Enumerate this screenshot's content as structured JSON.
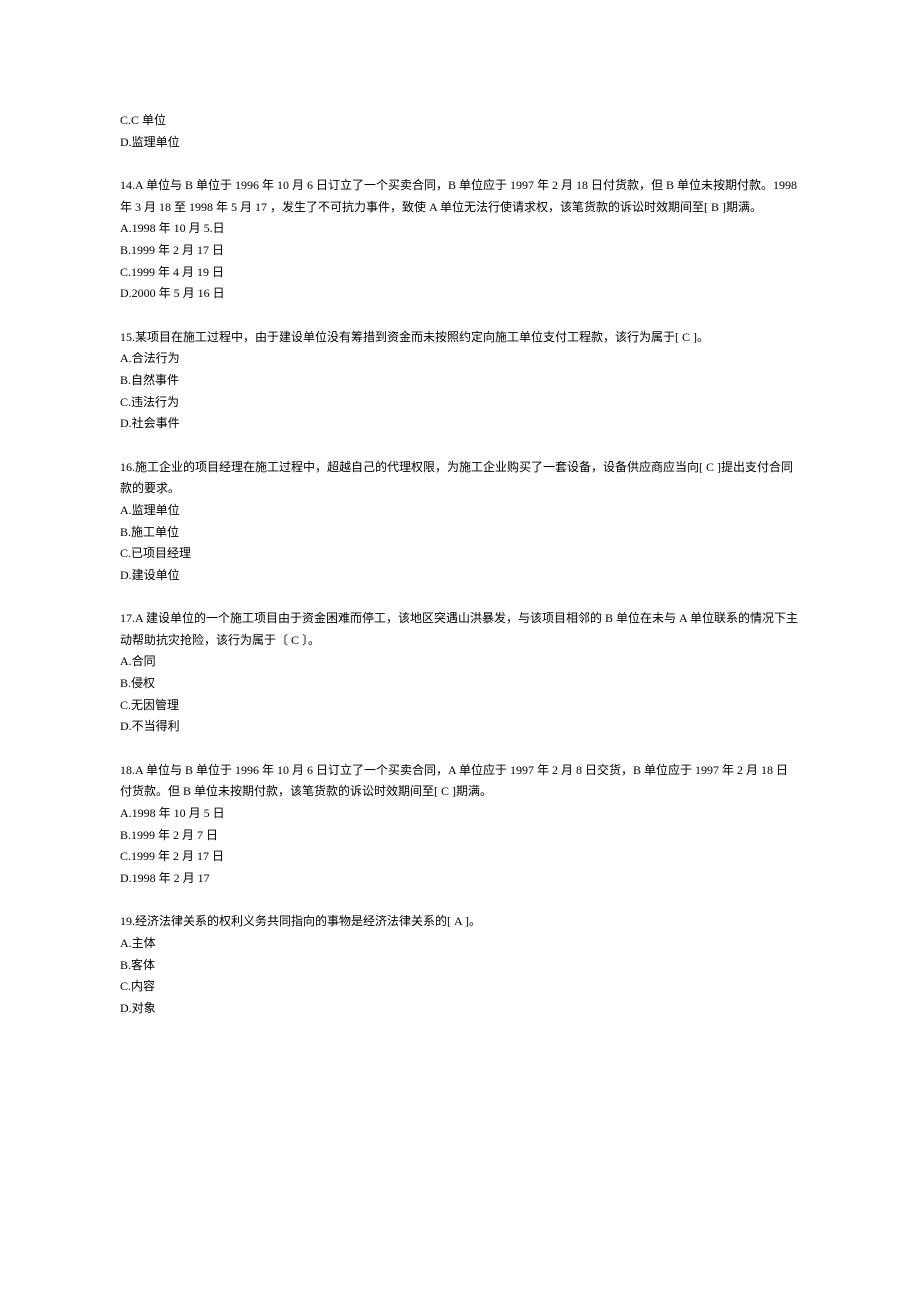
{
  "q13_tail": {
    "optC": "C.C 单位",
    "optD": "D.监理单位"
  },
  "q14": {
    "text": "14.A 单位与 B 单位于 1996 年 10 月 6 日订立了一个买卖合同，B 单位应于 1997 年 2 月 18 日付货款，但 B 单位未按期付款。1998 年 3 月 18 至 1998 年 5 月 17 ，发生了不可抗力事件，致使 A 单位无法行使请求权，该笔货款的诉讼时效期间至[ B ]期满。",
    "optA": "A.1998 年 10 月 5.日",
    "optB": "B.1999 年 2 月 17 日",
    "optC": "C.1999 年 4 月 19 日",
    "optD": "D.2000 年 5 月 16 日"
  },
  "q15": {
    "text": "15.某项目在施工过程中，由于建设单位没有筹措到资金而未按照约定向施工单位支付工程款，该行为属于[ C ]。",
    "optA": "A.合法行为",
    "optB": "B.自然事件",
    "optC": "C.违法行为",
    "optD": "D.社会事件"
  },
  "q16": {
    "text": "16.施工企业的项目经理在施工过程中，超越自己的代理权限，为施工企业购买了一套设备，设备供应商应当向[ C ]提出支付合同款的要求。",
    "optA": "A.监理单位",
    "optB": "B.施工单位",
    "optC": "C.已项目经理",
    "optD": "D.建设单位"
  },
  "q17": {
    "text": "17.A 建设单位的一个施工项目由于资金困难而停工，该地区突遇山洪暴发，与该项目相邻的 B 单位在未与 A 单位联系的情况下主动帮助抗灾抢险，该行为属于〔 C 〕。",
    "optA": "A.合同",
    "optB": "B.侵权",
    "optC": "C.无因管理",
    "optD": "D.不当得利"
  },
  "q18": {
    "text": "18.A 单位与 B 单位于 1996 年 10 月 6 日订立了一个买卖合同，A 单位应于 1997 年 2 月 8 日交货，B 单位应于 1997 年 2 月 18 日付货款。但 B 单位未按期付款，该笔货款的诉讼时效期间至[ C ]期满。",
    "optA": "A.1998 年 10 月 5 日",
    "optB": "B.1999 年 2 月 7 日",
    "optC": "C.1999 年 2 月 17 日",
    "optD": "D.1998 年 2 月 17"
  },
  "q19": {
    "text": "19.经济法律关系的权利义务共同指向的事物是经济法律关系的[ A ]。",
    "optA": "A.主体",
    "optB": "B.客体",
    "optC": "C.内容",
    "optD": "D.对象"
  }
}
